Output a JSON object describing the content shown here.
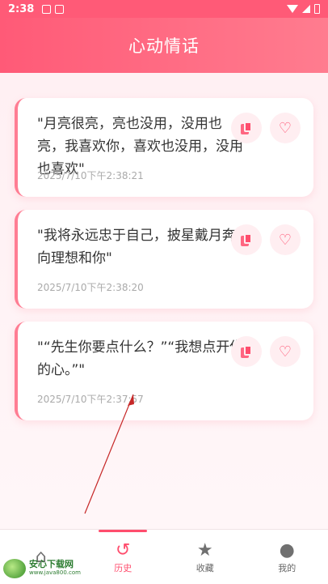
{
  "status_bar": {
    "time": "2:38"
  },
  "header": {
    "title": "心动情话"
  },
  "cards": [
    {
      "text": "\"月亮很亮，亮也没用，没用也亮，我喜欢你，喜欢也没用，没用也喜欢\"",
      "time": "2025/7/10下午2:38:21"
    },
    {
      "text": "\"我将永远忠于自己，披星戴月奔向理想和你\"",
      "time": "2025/7/10下午2:38:20"
    },
    {
      "text": "\"“先生你要点什么？”“我想点开你的心。”\"",
      "time": "2025/7/10下午2:37:57"
    }
  ],
  "tabs": [
    {
      "label": "",
      "icon": "home-icon"
    },
    {
      "label": "历史",
      "icon": "history-icon",
      "active": true
    },
    {
      "label": "收藏",
      "icon": "star-icon"
    },
    {
      "label": "我的",
      "icon": "person-icon"
    }
  ],
  "watermark": {
    "brand": "安心下载网",
    "url": "www.java800.com"
  },
  "colors": {
    "accent": "#ff4d6d",
    "header": "#ff5a77",
    "card_border": "#ff7d93"
  }
}
